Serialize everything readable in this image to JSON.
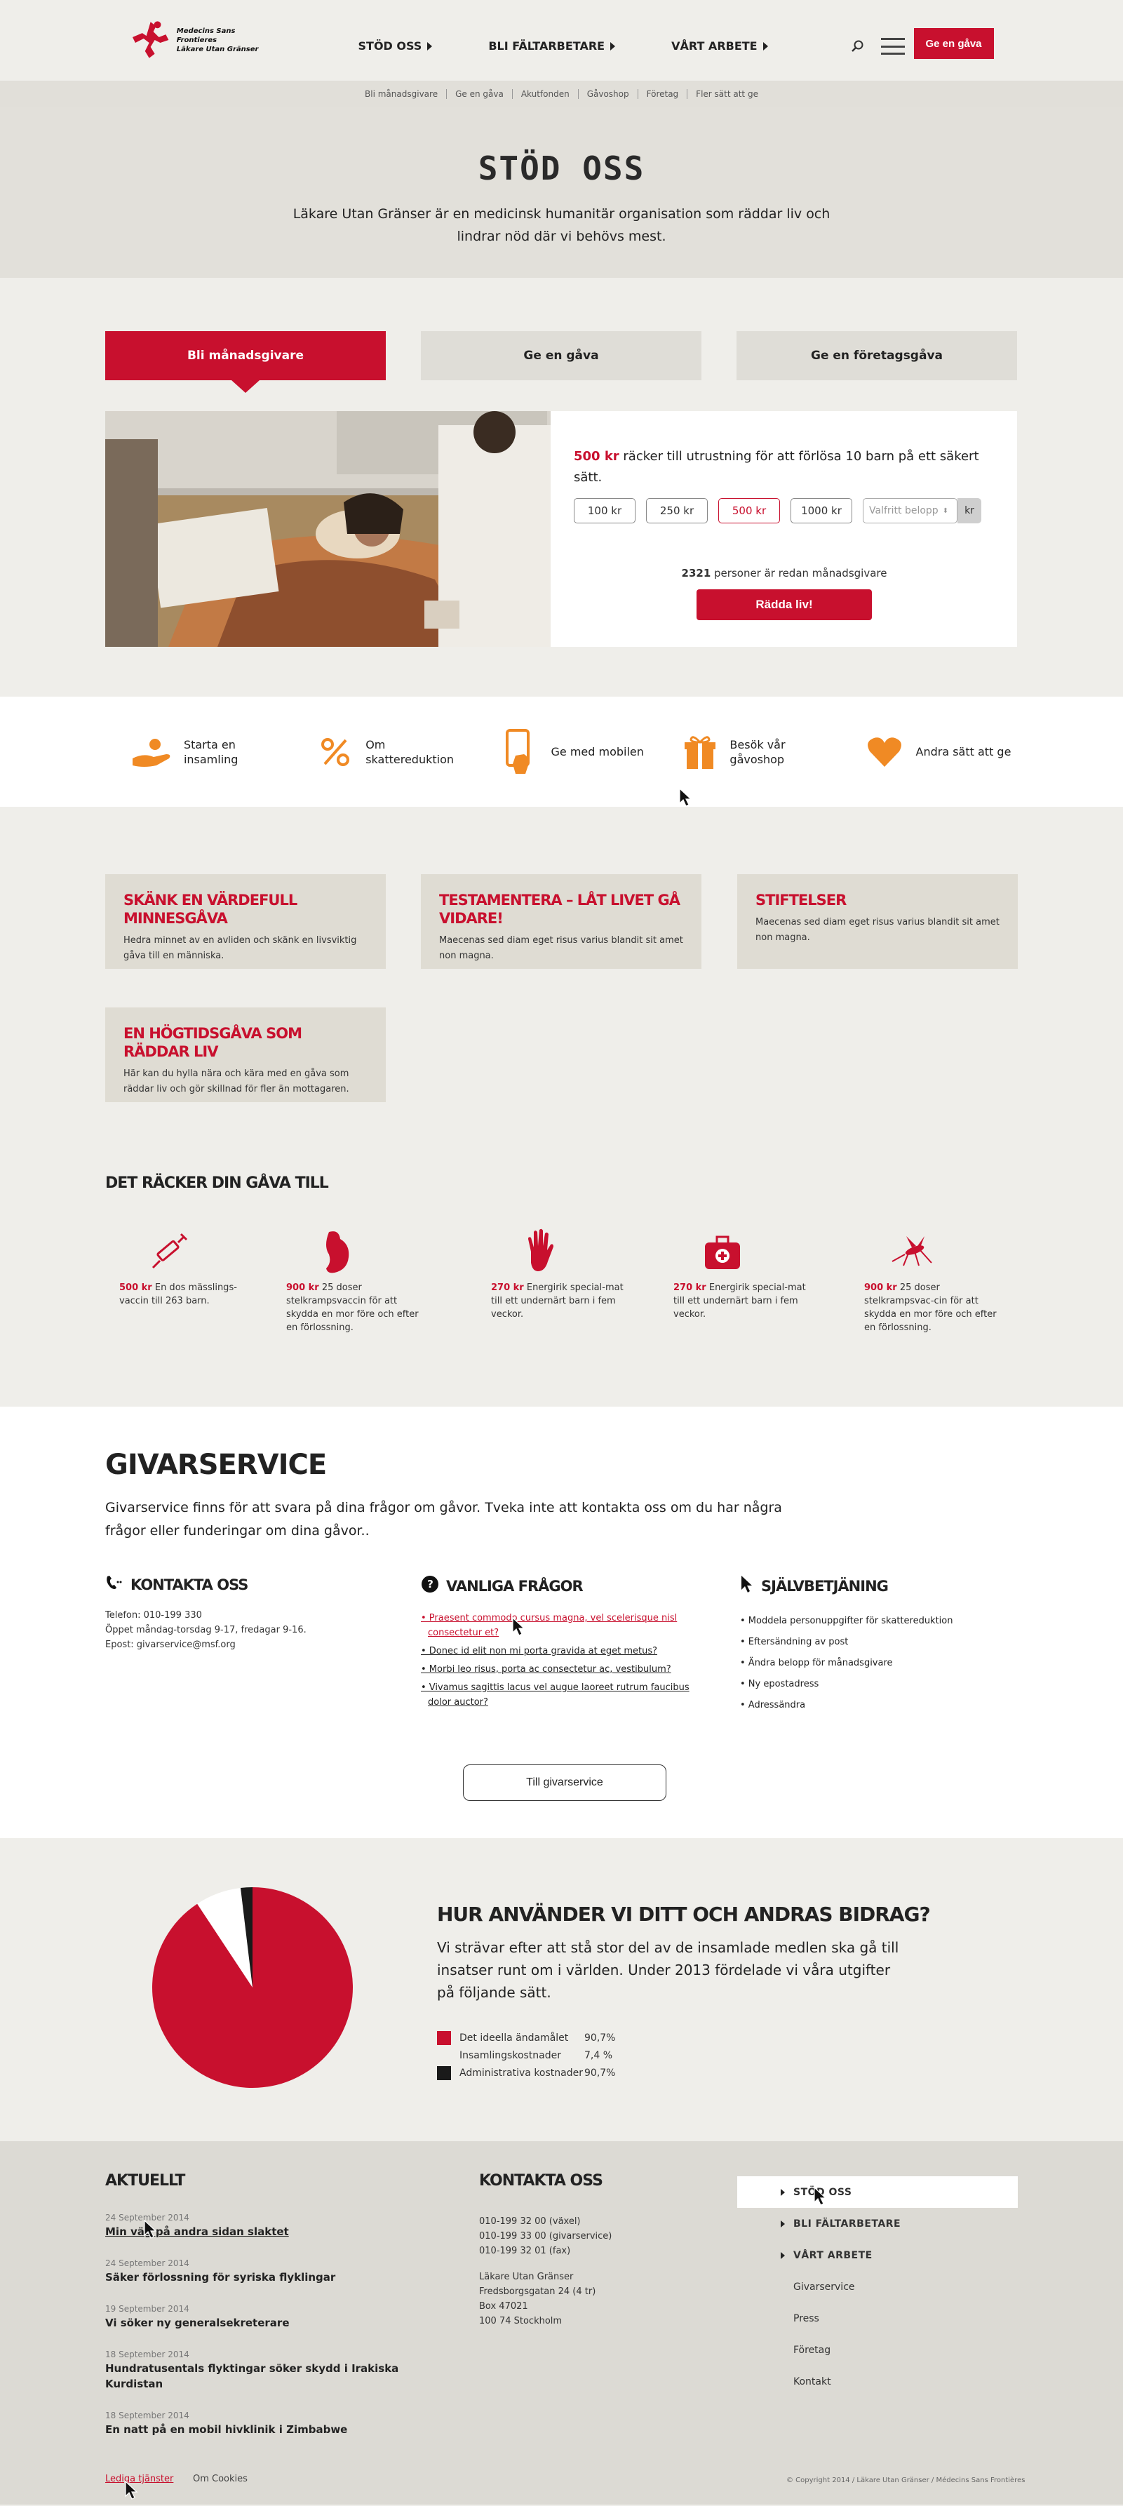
{
  "header": {
    "logo_line1": "Medecins Sans Frontieres",
    "logo_line2": "Läkare Utan Gränser",
    "nav": [
      "STÖD OSS",
      "BLI FÄLTARBETARE",
      "VÅRT ARBETE"
    ],
    "give_button": "Ge en gåva"
  },
  "subnav": [
    "Bli månadsgivare",
    "Ge en gåva",
    "Akutfonden",
    "Gåvoshop",
    "Företag",
    "Fler sätt att ge"
  ],
  "hero": {
    "title": "STÖD OSS",
    "text": "Läkare Utan Gränser är en medicinsk humanitär organisation som räddar liv och lindrar nöd där vi behövs mest."
  },
  "donate": {
    "tabs": [
      "Bli månadsgivare",
      "Ge en gåva",
      "Ge en företagsgåva"
    ],
    "msg_amount": "500 kr",
    "msg_text": " räcker till utrustning för att förlösa 10 barn på ett säkert sätt.",
    "amounts": [
      "100 kr",
      "250 kr",
      "500 kr",
      "1000 kr"
    ],
    "custom_placeholder": "Valfritt belopp",
    "currency": "kr",
    "donor_count": "2321",
    "donor_text": " personer är redan månadsgivare",
    "save_button": "Rädda liv!"
  },
  "ways": [
    {
      "label": "Starta en insamling",
      "icon": "hand-giving-icon"
    },
    {
      "label": "Om skattereduktion",
      "icon": "percent-icon"
    },
    {
      "label": "Ge med mobilen",
      "icon": "mobile-icon"
    },
    {
      "label": "Besök vår gåvoshop",
      "icon": "gift-icon"
    },
    {
      "label": "Andra sätt att ge",
      "icon": "heart-icon"
    }
  ],
  "gift_cards": [
    {
      "title": "SKÄNK EN VÄRDEFULL MINNESGÅVA",
      "text": "Hedra minnet av en avliden och skänk en livsviktig gåva till en människa."
    },
    {
      "title": "TESTAMENTERA – LÅT LIVET GÅ VIDARE!",
      "text": "Maecenas sed diam eget risus varius blandit sit amet non magna."
    },
    {
      "title": "STIFTELSER",
      "text": "Maecenas sed diam eget risus varius blandit sit amet non magna."
    },
    {
      "title": "EN HÖGTIDSGÅVA SOM RÄDDAR LIV",
      "text": "Här kan du hylla nära och kära med en gåva som räddar liv och gör skillnad för fler än mottagaren."
    }
  ],
  "gift_effect": {
    "title": "DET RÄCKER DIN GÅVA TILL",
    "items": [
      {
        "amount": "500 kr",
        "text": " En dos mässlings-vaccin till 263 barn.",
        "icon": "syringe-icon"
      },
      {
        "amount": "900 kr",
        "text": " 25 doser stelkrampsvaccin för att skydda en mor före och efter en förlossning.",
        "icon": "pregnant-icon"
      },
      {
        "amount": "270 kr",
        "text": " Energirik special-mat till ett undernärt barn i fem veckor.",
        "icon": "hand-icon"
      },
      {
        "amount": "270 kr",
        "text": " Energirik special-mat till ett undernärt barn i fem veckor.",
        "icon": "first-aid-kit-icon"
      },
      {
        "amount": "900 kr",
        "text": " 25 doser stelkrampsvac-cin för att skydda en mor före och efter en förlossning.",
        "icon": "mosquito-icon"
      }
    ]
  },
  "service": {
    "title": "GIVARSERVICE",
    "intro": "Givarservice finns för att svara på dina frågor om gåvor. Tveka inte att kontakta oss om du har några frågor eller funderingar om dina gåvor..",
    "contact_title": "KONTAKTA OSS",
    "contact_lines": [
      "Telefon: 010-199 330",
      "Öppet måndag-torsdag 9-17, fredagar 9-16.",
      "Epost: givarservice@msf.org"
    ],
    "faq_title": "VANLIGA FRÅGOR",
    "faq": [
      "• Praesent commodo cursus magna, vel scelerisque nisl consectetur et?",
      "• Donec id elit non mi porta gravida at eget metus?",
      "• Morbi leo risus, porta ac consectetur ac, vestibulum?",
      "• Vivamus sagittis lacus vel augue laoreet rutrum faucibus dolor auctor?"
    ],
    "self_title": "SJÄLVBETJÄNING",
    "self": [
      "• Moddela personuppgifter för skattereduktion",
      "• Eftersändning av post",
      "• Ändra belopp för månadsgivare",
      "• Ny epostadress",
      "• Adressändra"
    ],
    "button": "Till givarservice"
  },
  "usage": {
    "title": "HUR ANVÄNDER VI DITT OCH ANDRAS BIDRAG?",
    "text": "Vi strävar efter att stå stor del av de insamlade medlen ska gå till insatser runt om i världen. Under 2013 fördelade vi våra utgifter på följande sätt."
  },
  "chart_data": {
    "type": "pie",
    "labels": [
      "Det ideella ändamålet",
      "Insamlingskostnader",
      "Administrativa kostnader"
    ],
    "display_values": [
      "90,7%",
      "7,4 %",
      "90,7%"
    ],
    "values": [
      90.7,
      7.4,
      1.9
    ],
    "colors": [
      "#c8102e",
      "#ffffff",
      "#1a1a1a"
    ]
  },
  "footer": {
    "news_title": "AKTUELLT",
    "news": [
      {
        "date": "24 September 2014",
        "title": "Min väg på andra sidan slaktet"
      },
      {
        "date": "24 September 2014",
        "title": "Säker förlossning för syriska flyklingar"
      },
      {
        "date": "19 September 2014",
        "title": "Vi söker ny generalsekreterare"
      },
      {
        "date": "18 September 2014",
        "title": "Hundratusentals flyktingar söker skydd i Irakiska Kurdistan"
      },
      {
        "date": "18 September 2014",
        "title": "En natt på en mobil hivklinik i Zimbabwe"
      }
    ],
    "contact_title": "KONTAKTA OSS",
    "contact_lines": [
      "010-199 32 00 (växel)",
      "010-199 33 00 (givarservice)",
      "010-199 32 01 (fax)",
      "",
      "Läkare Utan Gränser",
      "Fredsborgsgatan 24 (4 tr)",
      "Box 47021",
      "100 74 Stockholm"
    ],
    "nav": [
      "STÖD OSS",
      "BLI FÄLTARBETARE",
      "VÅRT ARBETE",
      "Givarservice",
      "Press",
      "Företag",
      "Kontakt"
    ],
    "bottom_links": [
      "Lediga tjänster",
      "Om Cookies"
    ],
    "copyright": "© Copyright 2014 / Läkare Utan Gränser / Médecins Sans Frontières"
  }
}
